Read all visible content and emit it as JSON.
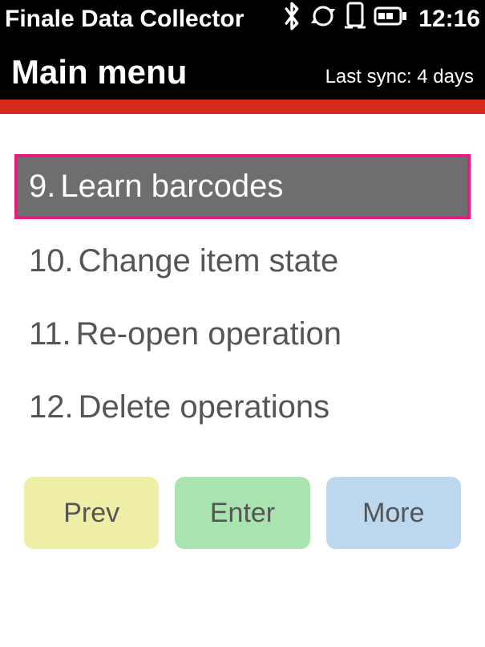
{
  "status": {
    "title": "Finale Data Collector",
    "time": "12:16"
  },
  "header": {
    "title": "Main menu",
    "sync_label": "Last sync: 4 days"
  },
  "menu": {
    "items": [
      {
        "num": "9.",
        "label": "Learn barcodes",
        "selected": true
      },
      {
        "num": "10.",
        "label": "Change item state",
        "selected": false
      },
      {
        "num": "11.",
        "label": "Re-open operation",
        "selected": false
      },
      {
        "num": "12.",
        "label": "Delete operations",
        "selected": false
      }
    ]
  },
  "buttons": {
    "prev": "Prev",
    "enter": "Enter",
    "more": "More"
  }
}
